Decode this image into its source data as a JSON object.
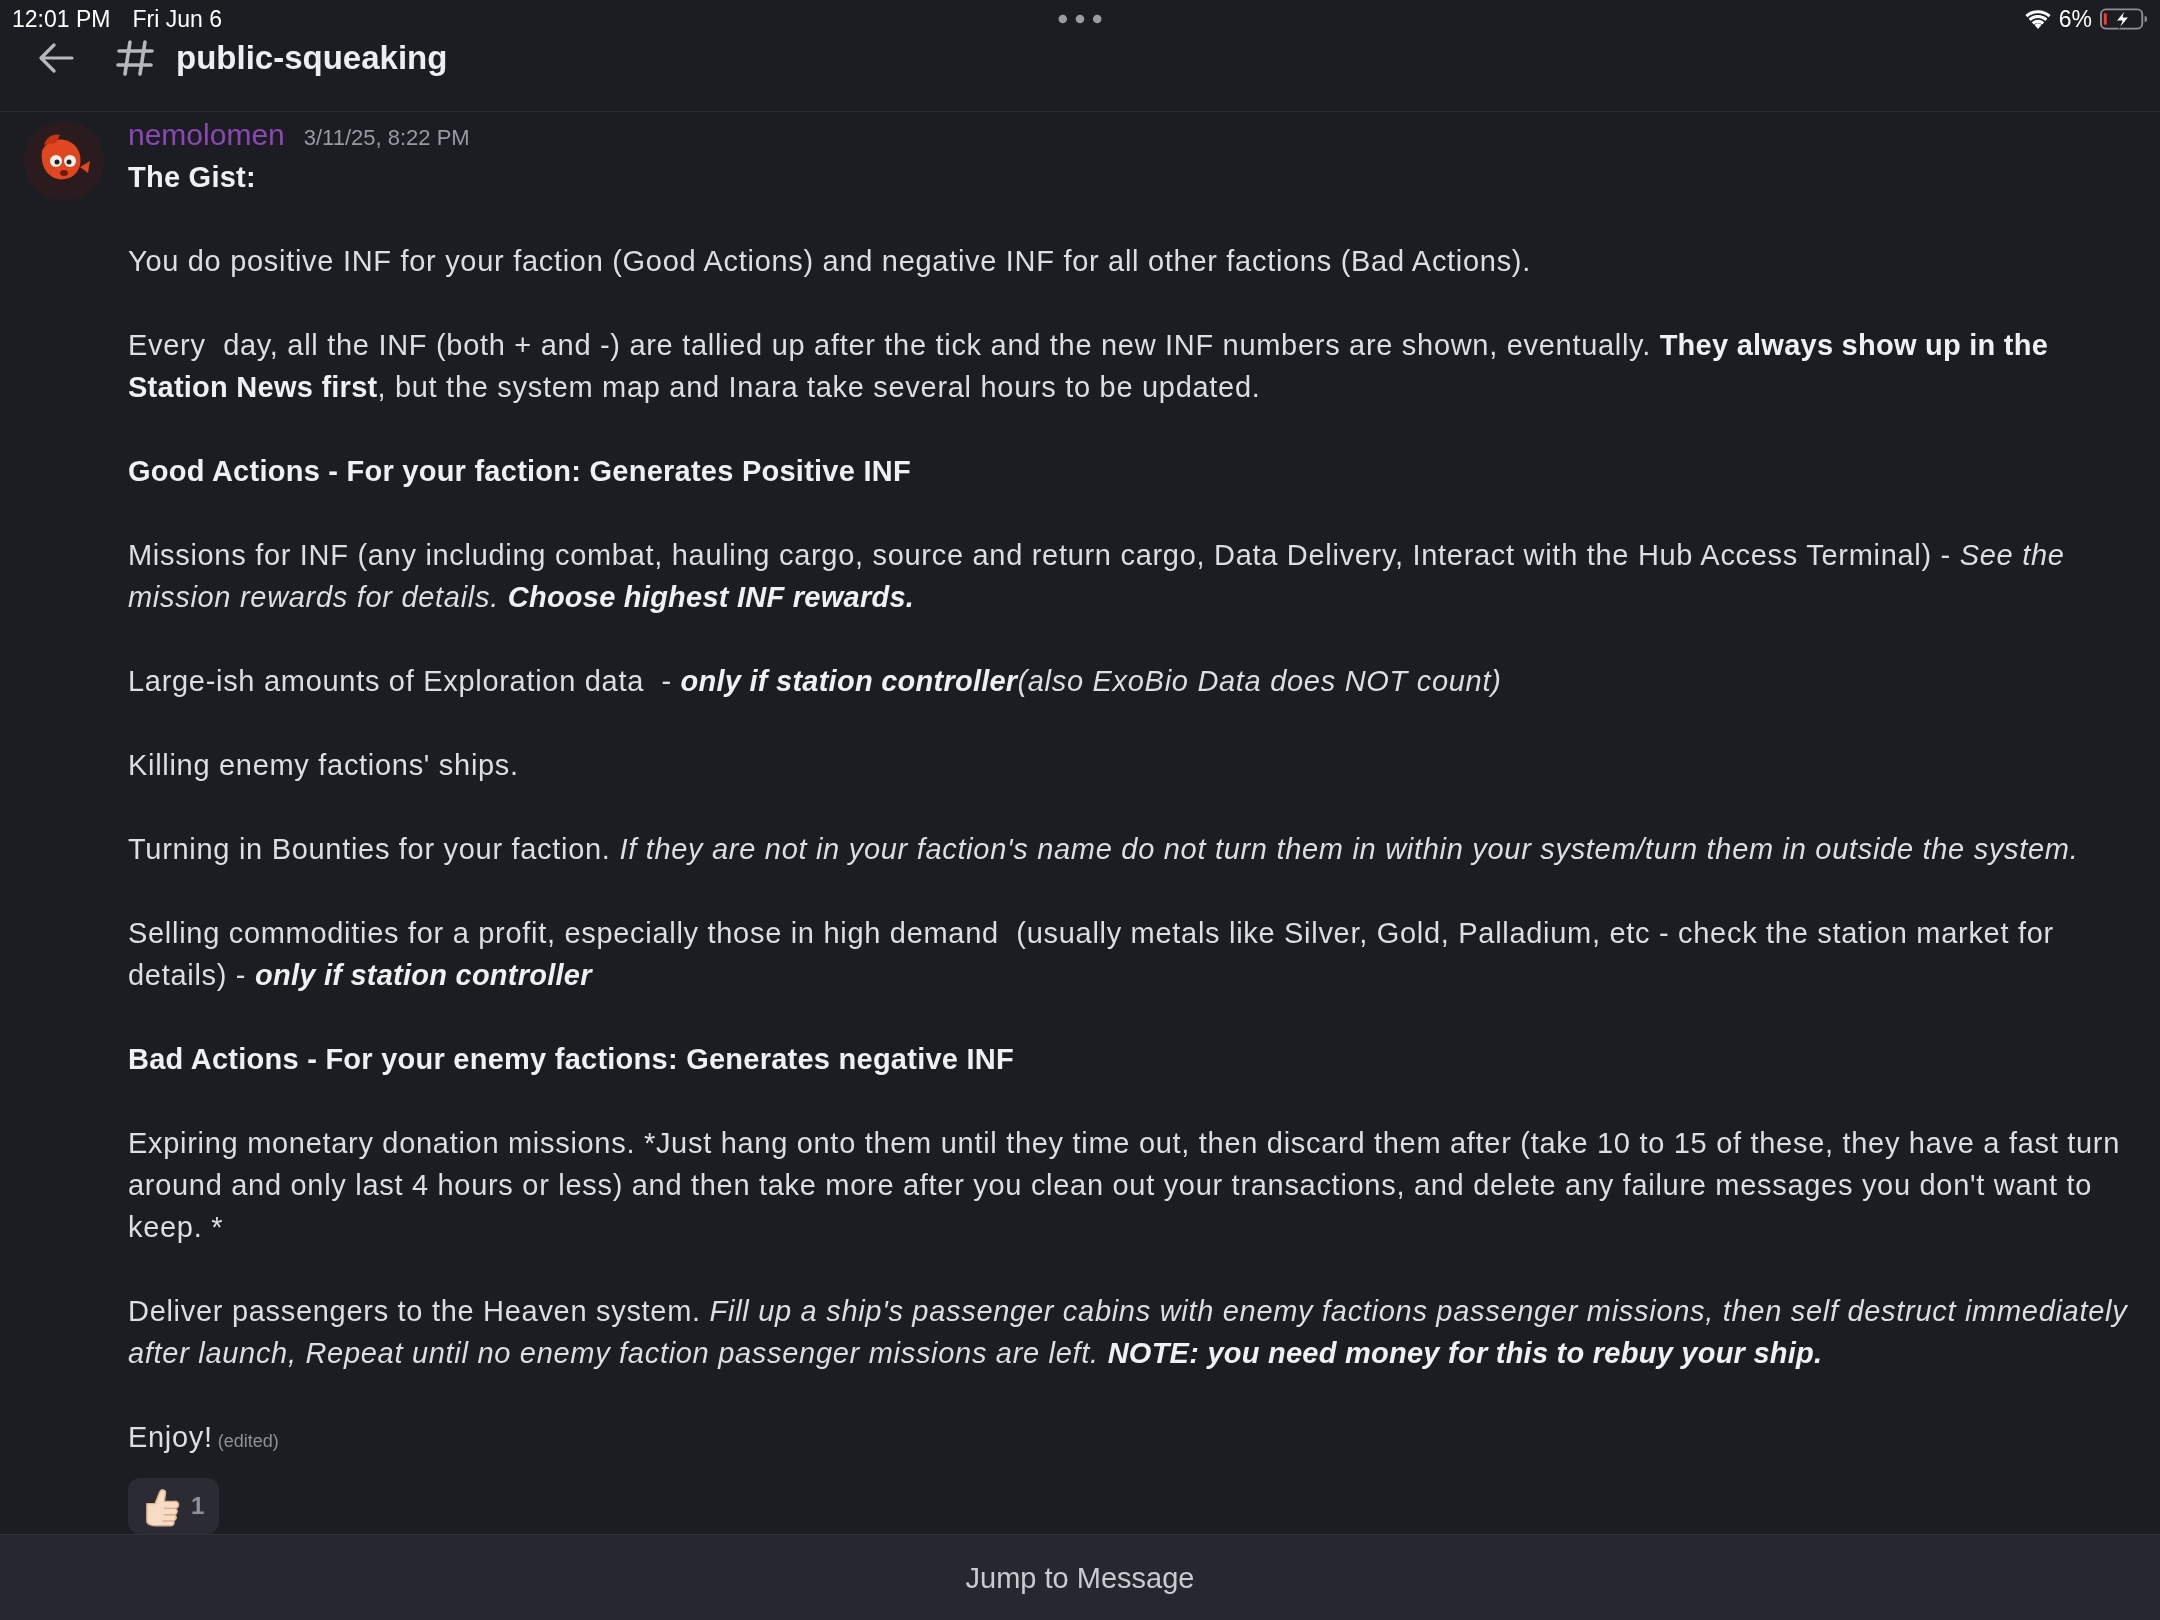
{
  "status_bar": {
    "time": "12:01 PM",
    "date": "Fri Jun 6",
    "battery": "6%"
  },
  "header": {
    "channel": "public-squeaking"
  },
  "message": {
    "author": "nemolomen",
    "timestamp": "3/11/25, 8:22 PM",
    "paragraphs": [
      {
        "kind": "heading",
        "text": "The Gist:"
      },
      {
        "kind": "text",
        "text": "You do positive INF for your faction (Good Actions) and negative INF for all other factions (Bad Actions)."
      },
      {
        "kind": "text",
        "text": "Every  day, all the INF (both + and -) are tallied up after the tick and the new INF numbers are shown, eventually. **They always show up in the Station News first**, but the system map and Inara take several hours to be updated."
      },
      {
        "kind": "heading",
        "text": "Good Actions - For your faction: Generates Positive INF"
      },
      {
        "kind": "emphatic",
        "text": "Missions for INF (any including combat, hauling cargo, source and return cargo, Data Delivery, Interact with the Hub Access Terminal) - *See the mission rewards for details.* **Choose highest INF rewards.**"
      },
      {
        "kind": "emphatic",
        "text": "Large-ish amounts of Exploration data  - **only if station controller**",
        "note": "(also ExoBio Data does NOT count)"
      },
      {
        "kind": "text",
        "text": "Killing enemy factions' ships."
      },
      {
        "kind": "text",
        "text": "Turning in Bounties for your faction. *If they are not in your faction's name do not turn them in within your system/turn them in outside the system.*"
      },
      {
        "kind": "emphatic",
        "text": "Selling commodities for a profit, especially those in high demand  (usually metals like Silver, Gold, Palladium, etc - check the station market for details) - **only if station controller**"
      },
      {
        "kind": "heading",
        "text": "Bad Actions - For your enemy factions: Generates negative INF"
      },
      {
        "kind": "plain",
        "text": "Expiring monetary donation missions. *Just hang onto them until they time out, then discard them after (take 10 to 15 of these, they have a fast turn around and only last 4 hours or less) and then take more after you clean out your transactions, and delete any failure messages you don't want to keep. *"
      },
      {
        "kind": "emphatic",
        "text": "Deliver passengers to the Heaven system. *Fill up a ship's passenger cabins with enemy factions passenger missions, then self destruct immediately after launch, Repeat until no enemy faction passenger missions are left.* **NOTE: you need money for this to rebuy your ship.**"
      },
      {
        "kind": "text",
        "text": "Enjoy!",
        "edited": "(edited)"
      }
    ],
    "reactions": [
      {
        "count": "1",
        "selected": false
      }
    ]
  },
  "jump_bar": {
    "label": "Jump to Message"
  }
}
